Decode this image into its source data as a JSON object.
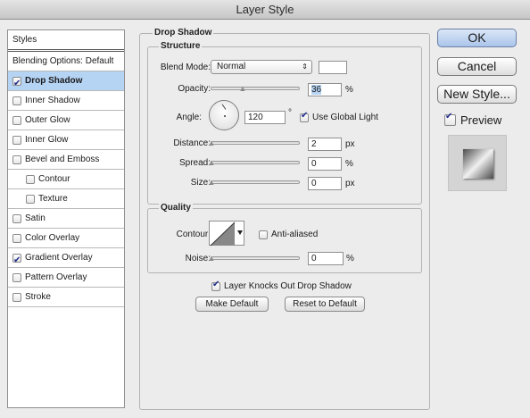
{
  "window": {
    "title": "Layer Style"
  },
  "styles_panel": {
    "header": "Styles",
    "items": [
      {
        "label": "Blending Options: Default",
        "checkbox": false,
        "checked": false,
        "selected": false,
        "sub": false
      },
      {
        "label": "Drop Shadow",
        "checkbox": true,
        "checked": true,
        "selected": true,
        "sub": false
      },
      {
        "label": "Inner Shadow",
        "checkbox": true,
        "checked": false,
        "selected": false,
        "sub": false
      },
      {
        "label": "Outer Glow",
        "checkbox": true,
        "checked": false,
        "selected": false,
        "sub": false
      },
      {
        "label": "Inner Glow",
        "checkbox": true,
        "checked": false,
        "selected": false,
        "sub": false
      },
      {
        "label": "Bevel and Emboss",
        "checkbox": true,
        "checked": false,
        "selected": false,
        "sub": false
      },
      {
        "label": "Contour",
        "checkbox": true,
        "checked": false,
        "selected": false,
        "sub": true
      },
      {
        "label": "Texture",
        "checkbox": true,
        "checked": false,
        "selected": false,
        "sub": true
      },
      {
        "label": "Satin",
        "checkbox": true,
        "checked": false,
        "selected": false,
        "sub": false
      },
      {
        "label": "Color Overlay",
        "checkbox": true,
        "checked": false,
        "selected": false,
        "sub": false
      },
      {
        "label": "Gradient Overlay",
        "checkbox": true,
        "checked": true,
        "selected": false,
        "sub": false
      },
      {
        "label": "Pattern Overlay",
        "checkbox": true,
        "checked": false,
        "selected": false,
        "sub": false
      },
      {
        "label": "Stroke",
        "checkbox": true,
        "checked": false,
        "selected": false,
        "sub": false
      }
    ]
  },
  "drop_shadow": {
    "title": "Drop Shadow",
    "structure": {
      "title": "Structure",
      "blend_mode_label": "Blend Mode:",
      "blend_mode_value": "Normal",
      "opacity_label": "Opacity:",
      "opacity_value": "36",
      "opacity_fraction": 0.36,
      "percent": "%",
      "angle_label": "Angle:",
      "angle_value": "120",
      "degree": "°",
      "use_global_light_label": "Use Global Light",
      "use_global_light_checked": true,
      "distance_label": "Distance:",
      "distance_value": "2",
      "px": "px",
      "spread_label": "Spread:",
      "spread_value": "0",
      "size_label": "Size:",
      "size_value": "0"
    },
    "quality": {
      "title": "Quality",
      "contour_label": "Contour:",
      "anti_aliased_label": "Anti-aliased",
      "anti_aliased_checked": false,
      "noise_label": "Noise:",
      "noise_value": "0"
    },
    "knocks_out_label": "Layer Knocks Out Drop Shadow",
    "knocks_out_checked": true,
    "make_default_label": "Make Default",
    "reset_default_label": "Reset to Default"
  },
  "actions": {
    "ok_label": "OK",
    "cancel_label": "Cancel",
    "new_style_label": "New Style...",
    "preview_label": "Preview",
    "preview_checked": true
  },
  "colors": {
    "selection": "#b5d3f3",
    "check": "#1d2b8a",
    "shadow_color": "#ffffff"
  }
}
